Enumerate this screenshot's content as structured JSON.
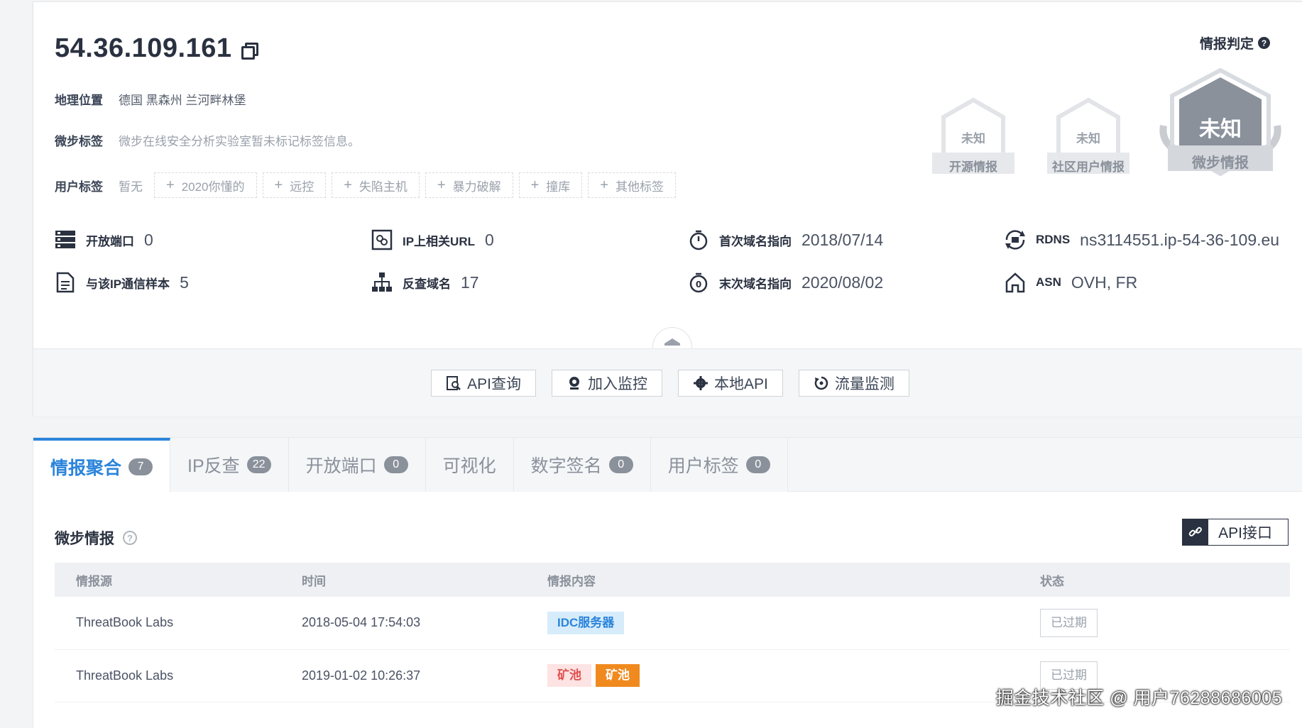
{
  "header": {
    "ip": "54.36.109.161",
    "geo_label": "地理位置",
    "geo_value": "德国 黑森州 兰河畔林堡",
    "wb_tag_label": "微步标签",
    "wb_tag_value": "微步在线安全分析实验室暂未标记标签信息。",
    "user_tag_label": "用户标签",
    "user_tag_empty": "暂无",
    "user_tags": [
      "2020你懂的",
      "远控",
      "失陷主机",
      "暴力破解",
      "撞库",
      "其他标签"
    ]
  },
  "verdict": {
    "title": "情报判定",
    "help": "?",
    "badges": [
      {
        "status": "未知",
        "label": "开源情报"
      },
      {
        "status": "未知",
        "label": "社区用户情报"
      },
      {
        "status": "未知",
        "label": "微步情报"
      }
    ]
  },
  "stats": {
    "open_ports": {
      "label": "开放端口",
      "value": "0"
    },
    "comm_samples": {
      "label": "与该IP通信样本",
      "value": "5"
    },
    "ip_urls": {
      "label": "IP上相关URL",
      "value": "0"
    },
    "reverse_domains": {
      "label": "反查域名",
      "value": "17"
    },
    "first_domain": {
      "label": "首次域名指向",
      "value": "2018/07/14"
    },
    "last_domain": {
      "label": "末次域名指向",
      "value": "2020/08/02"
    },
    "rdns": {
      "label": "RDNS",
      "value": "ns3114551.ip-54-36-109.eu"
    },
    "asn": {
      "label": "ASN",
      "value": "OVH, FR"
    }
  },
  "actions": [
    "API查询",
    "加入监控",
    "本地API",
    "流量监测"
  ],
  "tabs": [
    {
      "label": "情报聚合",
      "count": "7"
    },
    {
      "label": "IP反查",
      "count": "22"
    },
    {
      "label": "开放端口",
      "count": "0"
    },
    {
      "label": "可视化",
      "count": null
    },
    {
      "label": "数字签名",
      "count": "0"
    },
    {
      "label": "用户标签",
      "count": "0"
    }
  ],
  "section": {
    "title": "微步情报",
    "help": "?",
    "api_button": "API接口",
    "columns": [
      "情报源",
      "时间",
      "情报内容",
      "状态"
    ],
    "rows": [
      {
        "source": "ThreatBook Labs",
        "time": "2018-05-04 17:54:03",
        "tags": [
          "IDC服务器"
        ],
        "status": "已过期"
      },
      {
        "source": "ThreatBook Labs",
        "time": "2019-01-02 10:26:37",
        "tags": [
          "矿池",
          "矿池"
        ],
        "status": "已过期"
      }
    ]
  },
  "watermark": "掘金技术社区 @ 用户76288686005",
  "colors": {
    "accent": "#2b84db",
    "dark": "#2a3140",
    "warning": "#f08a1f",
    "danger": "#e25050"
  }
}
